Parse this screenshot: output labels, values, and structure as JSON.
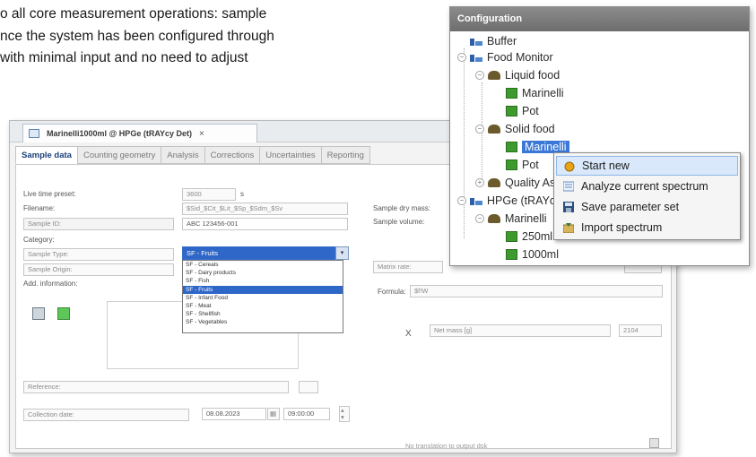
{
  "intro_lines": [
    "o all core measurement operations: sample",
    "nce the system has been configured through",
    " with minimal input and no need to adjust"
  ],
  "window": {
    "tab_title": "Marinelli1000ml @ HPGe (tRAYcy Det)",
    "tab_close": "×",
    "subtabs": [
      "Sample data",
      "Counting geometry",
      "Analysis",
      "Corrections",
      "Uncertainties",
      "Reporting"
    ]
  },
  "form": {
    "labels": {
      "live_time": "Live time preset:",
      "filename": "Filename:",
      "sample_id": "Sample ID:",
      "category": "Category:",
      "sample_type": "Sample Type:",
      "sample_origin": "Sample Origin:",
      "add_info": "Add. information:",
      "reference": "Reference:",
      "collection_date": "Collection date:",
      "sample_dry": "Sample dry mass:",
      "sample_volume": "Sample volume:",
      "formula": "Formula:",
      "x_label": "X",
      "no_assignment": "No translation to output dsk"
    },
    "values": {
      "live_time": "3600",
      "unit_s": "s",
      "filename": "$Sid_$Cit_$Lit_$Sp_$Sdm_$Sv",
      "sample_id": "ABC 123456-001",
      "date": "08.08.2023",
      "time": "09:00:00",
      "formula_val": "$f!W",
      "net_mass": "Net mass [g]",
      "net_mass_val": "2104",
      "matrix_label": "Matrix rate:"
    },
    "category_selected": "SF - Fruits",
    "category_options": [
      "SF - Cereals",
      "SF - Dairy products",
      "SF - Fish",
      "SF - Fruits",
      "SF - Infant Food",
      "SF - Meat",
      "SF - Shellfish",
      "SF - Vegetables"
    ],
    "category_selected_index": 3
  },
  "config": {
    "title": "Configuration",
    "nodes": {
      "buffer": "Buffer",
      "food_monitor": "Food Monitor",
      "liquid_food": "Liquid food",
      "marinelli_1": "Marinelli",
      "pot_1": "Pot",
      "solid_food": "Solid food",
      "marinelli_2": "Marinelli",
      "pot_2": "Pot",
      "quality": "Quality As",
      "hpge": "HPGe (tRAYc",
      "marinelli_3": "Marinelli",
      "ml250": "250ml",
      "ml1000": "1000ml"
    },
    "toggles": {
      "minus": "−",
      "plus": "+"
    }
  },
  "context_menu": {
    "items": [
      "Start new",
      "Analyze current spectrum",
      "Save parameter set",
      "Import spectrum"
    ]
  }
}
